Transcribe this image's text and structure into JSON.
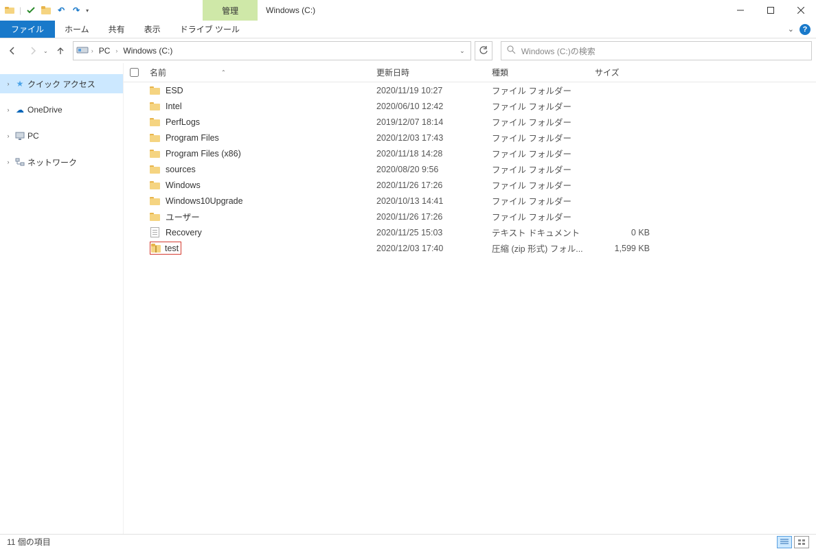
{
  "titlebar": {
    "context_tab": "管理",
    "window_title": "Windows (C:)"
  },
  "ribbon": {
    "file": "ファイル",
    "home": "ホーム",
    "share": "共有",
    "view": "表示",
    "drive_tools": "ドライブ ツール"
  },
  "address": {
    "pc": "PC",
    "current": "Windows (C:)"
  },
  "search": {
    "placeholder": "Windows (C:)の検索"
  },
  "sidebar": {
    "quick_access": "クイック アクセス",
    "onedrive": "OneDrive",
    "pc": "PC",
    "network": "ネットワーク"
  },
  "columns": {
    "name": "名前",
    "date": "更新日時",
    "type": "種類",
    "size": "サイズ"
  },
  "type_labels": {
    "folder": "ファイル フォルダー",
    "text": "テキスト ドキュメント",
    "zip": "圧縮 (zip 形式) フォル..."
  },
  "files": [
    {
      "name": "ESD",
      "date": "2020/11/19 10:27",
      "type": "folder",
      "size": ""
    },
    {
      "name": "Intel",
      "date": "2020/06/10 12:42",
      "type": "folder",
      "size": ""
    },
    {
      "name": "PerfLogs",
      "date": "2019/12/07 18:14",
      "type": "folder",
      "size": ""
    },
    {
      "name": "Program Files",
      "date": "2020/12/03 17:43",
      "type": "folder",
      "size": ""
    },
    {
      "name": "Program Files (x86)",
      "date": "2020/11/18 14:28",
      "type": "folder",
      "size": ""
    },
    {
      "name": "sources",
      "date": "2020/08/20 9:56",
      "type": "folder",
      "size": ""
    },
    {
      "name": "Windows",
      "date": "2020/11/26 17:26",
      "type": "folder",
      "size": ""
    },
    {
      "name": "Windows10Upgrade",
      "date": "2020/10/13 14:41",
      "type": "folder",
      "size": ""
    },
    {
      "name": "ユーザー",
      "date": "2020/11/26 17:26",
      "type": "folder",
      "size": ""
    },
    {
      "name": "Recovery",
      "date": "2020/11/25 15:03",
      "type": "text",
      "size": "0 KB"
    },
    {
      "name": "test",
      "date": "2020/12/03 17:40",
      "type": "zip",
      "size": "1,599 KB",
      "highlight": true
    }
  ],
  "status": {
    "count": "11 個の項目"
  }
}
